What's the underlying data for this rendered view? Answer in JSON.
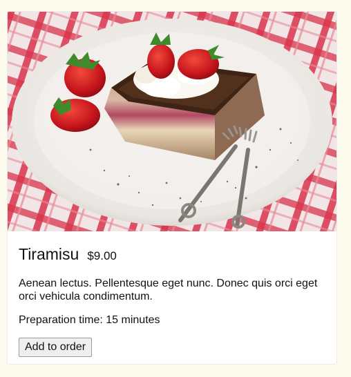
{
  "dish": {
    "name": "Tiramisu",
    "price": "$9.00",
    "description": "Aenean lectus. Pellentesque eget nunc. Donec quis orci eget orci vehicula condimentum.",
    "prep_time": "Preparation time: 15 minutes"
  },
  "actions": {
    "add_label": "Add to order"
  },
  "colors": {
    "page_bg": "#fdfaee",
    "tablecloth_red": "#d8344c",
    "plate": "#f4f2ef",
    "cream": "#fbf8f2",
    "strawberry": "#cc1c22"
  }
}
